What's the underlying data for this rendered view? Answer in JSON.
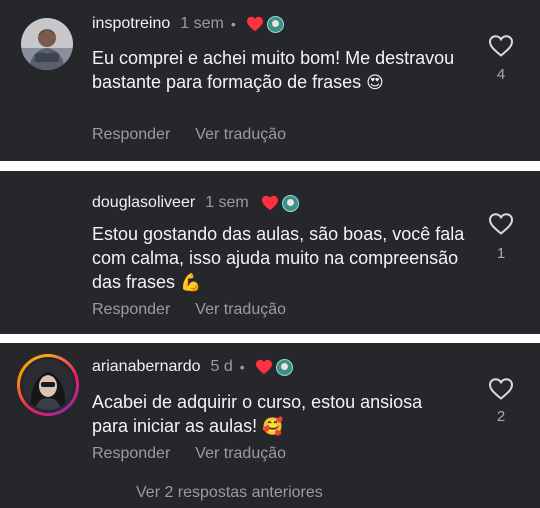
{
  "comments": [
    {
      "username": "inspotreino",
      "time": "1 sem",
      "text": "Eu comprei e achei muito bom! Me destravou bastante para formação de frases",
      "emoji": "😍",
      "likes": "4",
      "reply_label": "Responder",
      "translate_label": "Ver tradução"
    },
    {
      "username": "douglasoliveer",
      "time": "1 sem",
      "text": "Estou gostando das aulas, são boas, você fala com calma, isso ajuda muito na compreensão das frases",
      "emoji": "💪",
      "likes": "1",
      "reply_label": "Responder",
      "translate_label": "Ver tradução"
    },
    {
      "username": "arianabernardo",
      "time": "5 d",
      "dot": "•",
      "text": "Acabei de adquirir o curso, estou ansiosa para iniciar as aulas!",
      "emoji": "🥰",
      "likes": "2",
      "reply_label": "Responder",
      "translate_label": "Ver tradução",
      "more_replies": "Ver 2 respostas anteriores"
    }
  ],
  "colors": {
    "card_bg": "#26272b",
    "separator": "#ffffff",
    "heart_red": "#ff3040",
    "muted_text": "#9a9ba1"
  }
}
